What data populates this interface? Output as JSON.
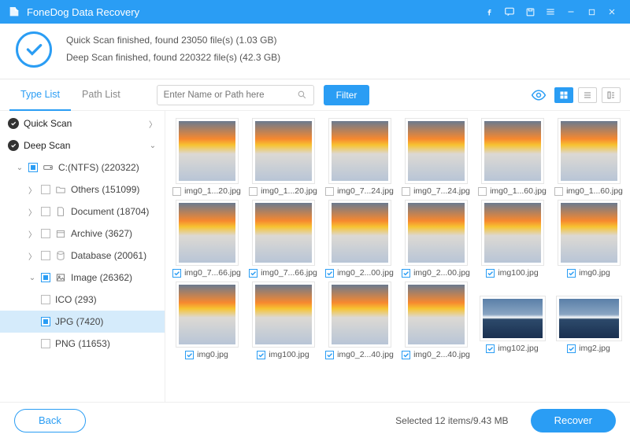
{
  "app": {
    "title": "FoneDog Data Recovery"
  },
  "scan": {
    "line1": "Quick Scan finished, found 23050 file(s) (1.03 GB)",
    "line2": "Deep Scan finished, found 220322 file(s) (42.3 GB)"
  },
  "tabs": {
    "type": "Type List",
    "path": "Path List"
  },
  "search": {
    "placeholder": "Enter Name or Path here"
  },
  "filter": "Filter",
  "tree": {
    "quick": "Quick Scan",
    "deep": "Deep Scan",
    "drive": "C:(NTFS) (220322)",
    "others": "Others (151099)",
    "document": "Document (18704)",
    "archive": "Archive (3627)",
    "database": "Database (20061)",
    "image": "Image (26362)",
    "ico": "ICO (293)",
    "jpg": "JPG (7420)",
    "png": "PNG (11653)"
  },
  "files": [
    {
      "name": "img0_1...20.jpg",
      "sel": false,
      "wide": false
    },
    {
      "name": "img0_1...20.jpg",
      "sel": false,
      "wide": false
    },
    {
      "name": "img0_7...24.jpg",
      "sel": false,
      "wide": false
    },
    {
      "name": "img0_7...24.jpg",
      "sel": false,
      "wide": false
    },
    {
      "name": "img0_1...60.jpg",
      "sel": false,
      "wide": false
    },
    {
      "name": "img0_1...60.jpg",
      "sel": false,
      "wide": false
    },
    {
      "name": "img0_7...66.jpg",
      "sel": true,
      "wide": false
    },
    {
      "name": "img0_7...66.jpg",
      "sel": true,
      "wide": false
    },
    {
      "name": "img0_2...00.jpg",
      "sel": true,
      "wide": false
    },
    {
      "name": "img0_2...00.jpg",
      "sel": true,
      "wide": false
    },
    {
      "name": "img100.jpg",
      "sel": true,
      "wide": false
    },
    {
      "name": "img0.jpg",
      "sel": true,
      "wide": false
    },
    {
      "name": "img0.jpg",
      "sel": true,
      "wide": false
    },
    {
      "name": "img100.jpg",
      "sel": true,
      "wide": false
    },
    {
      "name": "img0_2...40.jpg",
      "sel": true,
      "wide": false
    },
    {
      "name": "img0_2...40.jpg",
      "sel": true,
      "wide": false
    },
    {
      "name": "img102.jpg",
      "sel": true,
      "wide": true
    },
    {
      "name": "img2.jpg",
      "sel": true,
      "wide": true
    }
  ],
  "footer": {
    "back": "Back",
    "status": "Selected 12 items/9.43 MB",
    "recover": "Recover"
  }
}
